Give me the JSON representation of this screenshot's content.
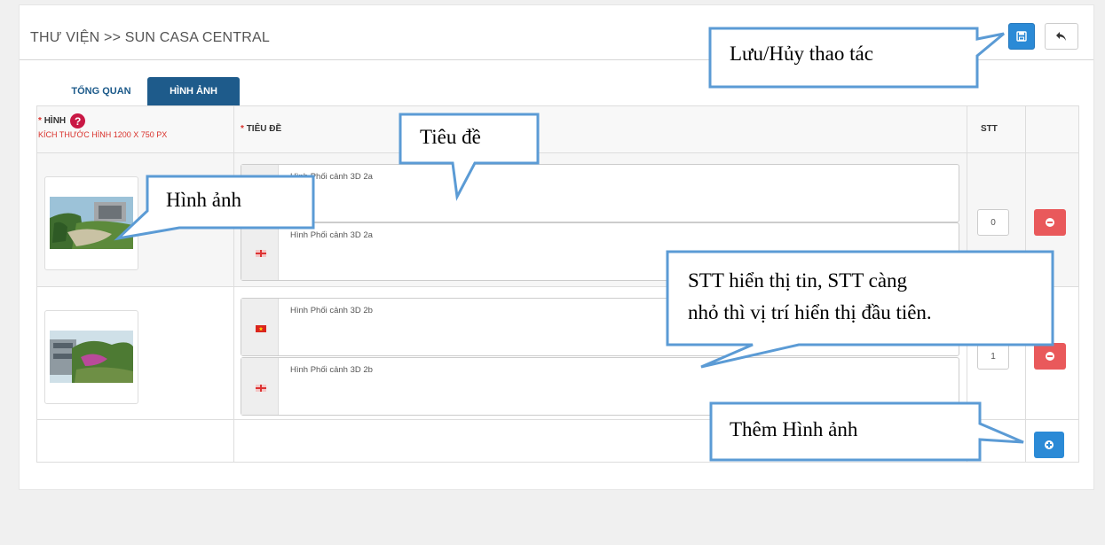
{
  "header": {
    "title": "THƯ VIỆN >> SUN CASA CENTRAL"
  },
  "tabs": [
    {
      "label": "TỔNG QUAN",
      "active": false
    },
    {
      "label": "HÌNH ẢNH",
      "active": true
    }
  ],
  "table": {
    "col_image_label": "HÌNH",
    "col_image_required": "*",
    "col_image_help": "?",
    "col_image_hint": "KÍCH THƯỚC HÌNH 1200 X 750 PX",
    "col_title_label": "TIÊU ĐỀ",
    "col_title_required": "*",
    "col_stt_label": "STT",
    "rows": [
      {
        "title_vi": "Hình  Phối cảnh 3D 2a",
        "title_en": "Hình  Phối cảnh 3D 2a",
        "stt": "0"
      },
      {
        "title_vi": "Hình  Phối cảnh 3D 2b",
        "title_en": "Hình  Phối cảnh 3D 2b",
        "stt": "1"
      }
    ]
  },
  "callouts": {
    "save_cancel": "Lưu/Hủy thao tác",
    "title": "Tiêu đề",
    "image": "Hình ảnh",
    "stt_line1": "STT hiển thị tin, STT càng",
    "stt_line2": "nhỏ thì vị trí hiển thị đầu tiên.",
    "add_image": "Thêm Hình ảnh"
  },
  "colors": {
    "primary": "#2b8ad6",
    "tab_active": "#1e5b8b",
    "danger": "#e9595b",
    "required": "#d9312b",
    "callout_border": "#5b9bd5"
  },
  "icons": {
    "save": "floppy-disk-icon",
    "undo": "undo-arrow-icon",
    "help": "question-circle-icon",
    "remove": "minus-circle-icon",
    "add": "plus-circle-icon",
    "flag_vi": "vietnam-flag-icon",
    "flag_en": "uk-flag-icon"
  }
}
